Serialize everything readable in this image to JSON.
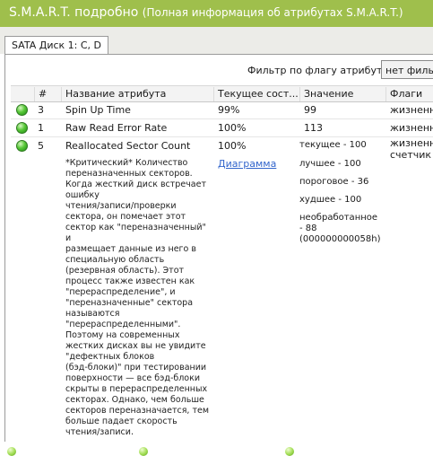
{
  "window": {
    "title": "S.M.A.R.T. подробно",
    "subtitle": "(Полная информация об атрибутах S.M.A.R.T.)"
  },
  "tab": {
    "label": "SATA Диск 1: C, D"
  },
  "filter": {
    "label": "Фильтр по флагу атрибута:",
    "value": "нет фильтр"
  },
  "columns": [
    "#",
    "Название атрибута",
    "Текущее сост...",
    "Значение",
    "Флаги"
  ],
  "rows": [
    {
      "status": "ok",
      "id": "3",
      "name": "Spin Up Time",
      "current": "99%",
      "value": "99",
      "flags": "жизненно-..."
    },
    {
      "status": "ok",
      "id": "1",
      "name": "Raw Read Error Rate",
      "current": "100%",
      "value": "113",
      "flags": "жизненно-..."
    },
    {
      "status": "ok",
      "id": "5",
      "name": "Reallocated Sector Count",
      "current": "100%",
      "link": "Диаграмма",
      "flags_line1": "жизненно-",
      "flags_line2": "счетчик с...",
      "values": {
        "current": "текущее - 100",
        "best": "лучшее - 100",
        "threshold": "пороговое - 36",
        "worst": "худшее - 100",
        "raw_1": "необработанное",
        "raw_2": "- 88",
        "raw_3": "(000000000058h)"
      },
      "description_lines": [
        "*Критический* Количество",
        "переназначенных секторов.",
        "Когда жесткий диск встречает",
        "ошибку",
        "чтения/записи/проверки",
        "сектора, он помечает этот",
        "сектор как \"переназначенный\" и",
        "размещает данные из него в",
        "специальную область",
        "(резервная область). Этот",
        "процесс также известен как",
        "\"перераспределение\", и",
        "\"переназначенные\" сектора",
        "называются",
        "\"перераспределенными\".",
        "Поэтому на современных",
        "жестких дисках вы не увидите",
        "\"дефектных блоков",
        "(бэд-блоки)\" при тестировании",
        "поверхности — все бэд-блоки",
        "скрыты в перераспределенных",
        "секторах. Однако, чем больше",
        "секторов переназначается, тем",
        "больше падает скорость",
        "чтения/записи."
      ]
    }
  ],
  "colors": {
    "title_bar": "#9fbf4c",
    "status_ok": "#4cc22c",
    "link": "#3366cc"
  }
}
